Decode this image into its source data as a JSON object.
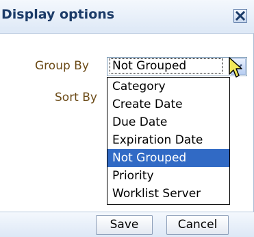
{
  "dialog": {
    "title": "Display options",
    "close_icon": "close-icon"
  },
  "form": {
    "group_by_label": "Group By",
    "sort_by_label": "Sort By",
    "group_by_value": "Not Grouped",
    "dropdown_icon": "chevron-down-icon"
  },
  "dropdown": {
    "options": [
      "Category",
      "Create Date",
      "Due Date",
      "Expiration Date",
      "Not Grouped",
      "Priority",
      "Worklist Server"
    ],
    "selected_index": 4
  },
  "footer": {
    "save_label": "Save",
    "cancel_label": "Cancel"
  },
  "cursor_icon": "pointer-cursor-icon"
}
